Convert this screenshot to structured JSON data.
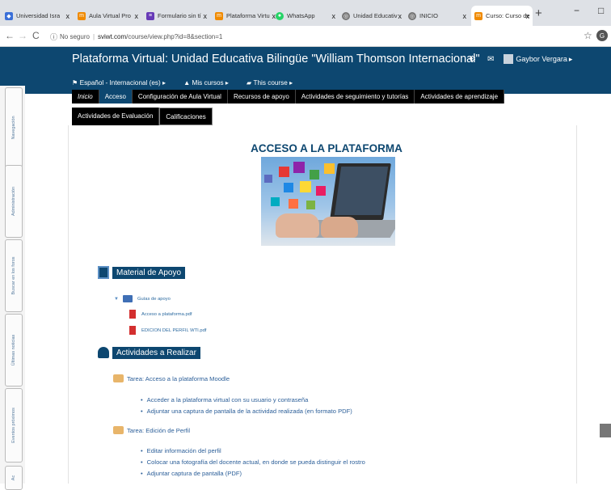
{
  "browser": {
    "tabs": [
      {
        "label": "Universidad Isra",
        "fav_color": "#3a6fd8",
        "fav_glyph": "◆"
      },
      {
        "label": "Aula Virtual Pro",
        "fav_color": "#f08a00",
        "fav_glyph": "m"
      },
      {
        "label": "Formulario sin tí",
        "fav_color": "#673ab7",
        "fav_glyph": "≡"
      },
      {
        "label": "Plataforma Virtu",
        "fav_color": "#f08a00",
        "fav_glyph": "m"
      },
      {
        "label": "WhatsApp",
        "fav_color": "#25d366",
        "fav_glyph": "●"
      },
      {
        "label": "Unidad Educativ",
        "fav_color": "#777777",
        "fav_glyph": "◎"
      },
      {
        "label": "INICIO",
        "fav_color": "#777777",
        "fav_glyph": "◎"
      },
      {
        "label": "Curso: Curso de",
        "fav_color": "#f08a00",
        "fav_glyph": "m"
      }
    ],
    "tab_close": "x",
    "new_tab": "+",
    "minimize": "−",
    "maximize": "□",
    "security_label": "No seguro",
    "url_host": "sviwt.com",
    "url_path": "/course/view.php?id=8&section=1",
    "profile_initial": "G"
  },
  "header": {
    "site_title": "Plataforma Virtual: Unidad Educativa Bilingüe \"William Thomson Internacional\"",
    "user_name": "Gaybor Vergara",
    "language": "Español - Internacional (es)",
    "my_courses": "Mis cursos",
    "this_course": "This course"
  },
  "course_tabs": {
    "row1": [
      "Inicio",
      "Acceso",
      "Configuración de Aula Virtual",
      "Recursos de apoyo",
      "Actividades de seguimiento y tutorías",
      "Actividades de aprendizaje"
    ],
    "row2": [
      "Actividades de Evaluación",
      "Calificaciones"
    ]
  },
  "blocks": [
    "Navegación",
    "Administración",
    "Buscar en los foros",
    "Últimas noticias",
    "Eventos próximos",
    "Ac"
  ],
  "page": {
    "heading": "ACCESO A LA PLATAFORMA",
    "material_heading": "Material de Apoyo",
    "folder_label": "Guías de apoyo",
    "files": [
      "Acceso a plataforma.pdf",
      "EDICION DEL PERFIL WTI.pdf"
    ],
    "activities_heading": "Actividades a Realizar",
    "task1": {
      "title": "Tarea: Acceso a la plataforma Moodle",
      "items": [
        "Acceder a la plataforma virtual con su usuario y contraseña",
        "Adjuntar una captura de pantalla de la actividad realizada (en formato PDF)"
      ]
    },
    "task2": {
      "title": "Tarea: Edición de Perfil",
      "items": [
        "Editar información del perfil",
        "Colocar una fotografía del docente actual, en donde se pueda distinguir el rostro",
        "Adjuntar captura de pantalla (PDF)"
      ]
    }
  },
  "colors": {
    "brand": "#0d4770",
    "link": "#2c5f99",
    "tab_black": "#000000"
  }
}
